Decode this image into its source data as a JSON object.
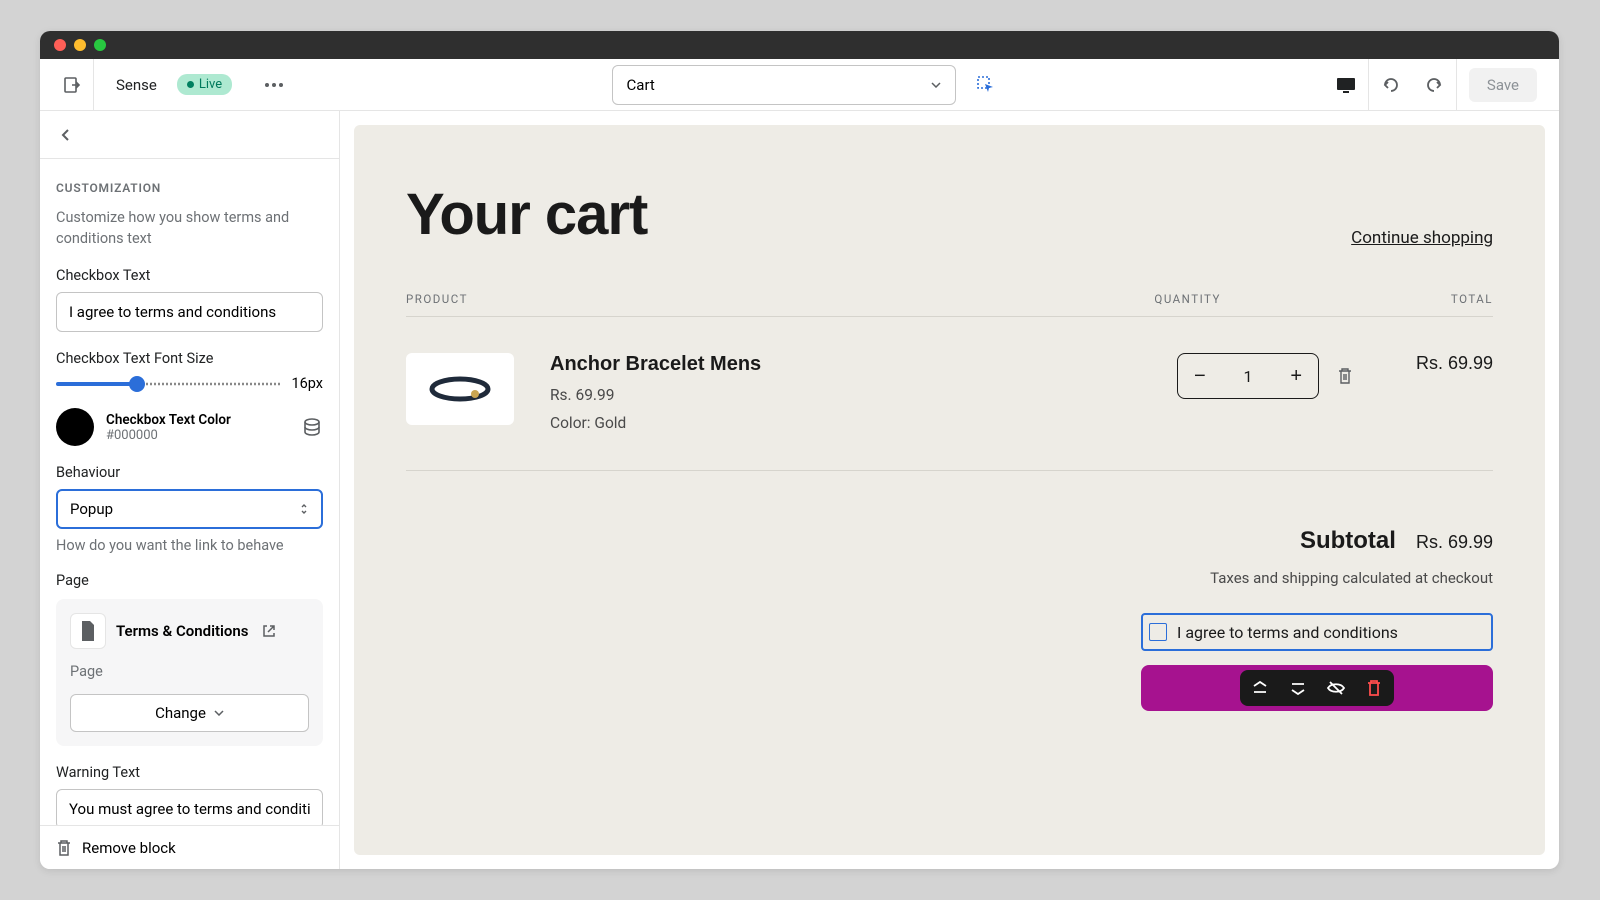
{
  "topbar": {
    "theme_name": "Sense",
    "live_label": "Live",
    "page_select": "Cart",
    "save_label": "Save"
  },
  "sidebar": {
    "section_title": "CUSTOMIZATION",
    "section_desc": "Customize how you show terms and conditions text",
    "checkbox_text_label": "Checkbox Text",
    "checkbox_text_value": "I agree to terms and conditions",
    "font_size_label": "Checkbox Text Font Size",
    "font_size_value": "16px",
    "color_label": "Checkbox Text Color",
    "color_hex": "#000000",
    "behaviour_label": "Behaviour",
    "behaviour_value": "Popup",
    "behaviour_hint": "How do you want the link to behave",
    "page_label": "Page",
    "page_name": "Terms & Conditions",
    "page_sublabel": "Page",
    "change_label": "Change",
    "warning_label": "Warning Text",
    "warning_value": "You must agree to terms and conditio",
    "remove_label": "Remove block"
  },
  "preview": {
    "cart_title": "Your cart",
    "continue_link": "Continue shopping",
    "col_product": "PRODUCT",
    "col_quantity": "QUANTITY",
    "col_total": "TOTAL",
    "product": {
      "name": "Anchor Bracelet Mens",
      "price": "Rs. 69.99",
      "variant": "Color: Gold",
      "qty": "1",
      "line_total": "Rs. 69.99"
    },
    "subtotal_label": "Subtotal",
    "subtotal_value": "Rs. 69.99",
    "tax_note": "Taxes and shipping calculated at checkout",
    "agree_text": "I agree to terms and conditions"
  }
}
